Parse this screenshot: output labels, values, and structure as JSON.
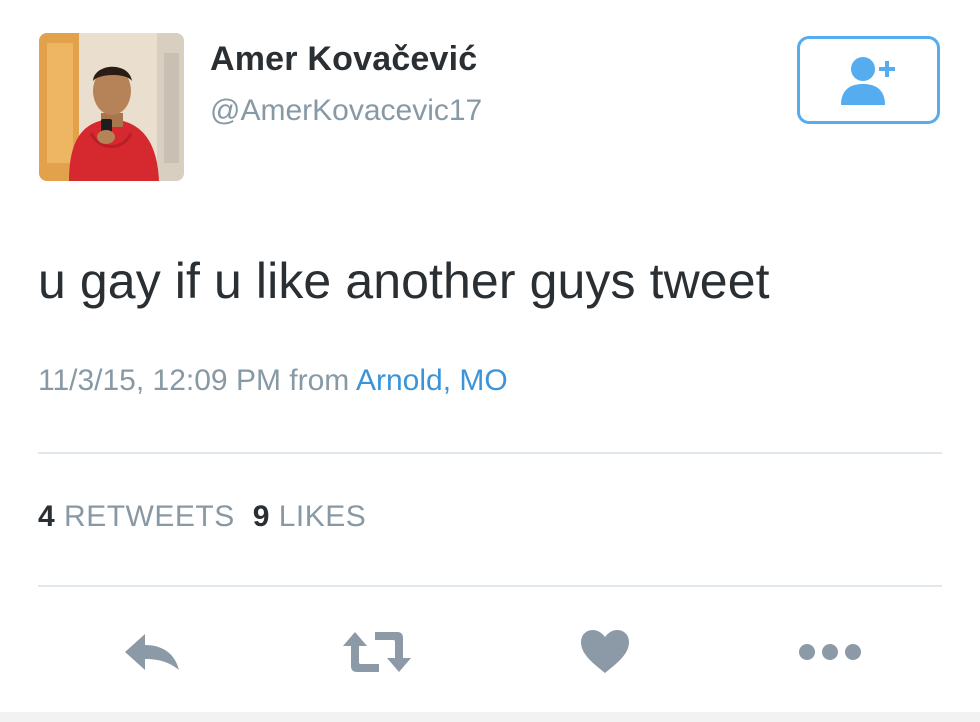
{
  "user": {
    "name": "Amer Kovačević",
    "handle": "@AmerKovacevic17"
  },
  "follow_button": {
    "icon": "follow-user-plus-icon"
  },
  "tweet": {
    "text": "u gay if u like another guys tweet",
    "timestamp": "11/3/15, 12:09 PM",
    "from_label": "from",
    "location": "Arnold, MO"
  },
  "stats": {
    "retweets_count": "4",
    "retweets_label": "RETWEETS",
    "likes_count": "9",
    "likes_label": "LIKES"
  },
  "actions": {
    "reply_icon": "reply-icon",
    "retweet_icon": "retweet-icon",
    "like_icon": "heart-icon",
    "more_icon": "more-dots-icon"
  },
  "colors": {
    "accent": "#55acee",
    "link": "#3b94d9",
    "muted": "#8899a6",
    "text": "#292f33",
    "icon": "#8b9aa6",
    "divider": "#e1e8ed"
  }
}
